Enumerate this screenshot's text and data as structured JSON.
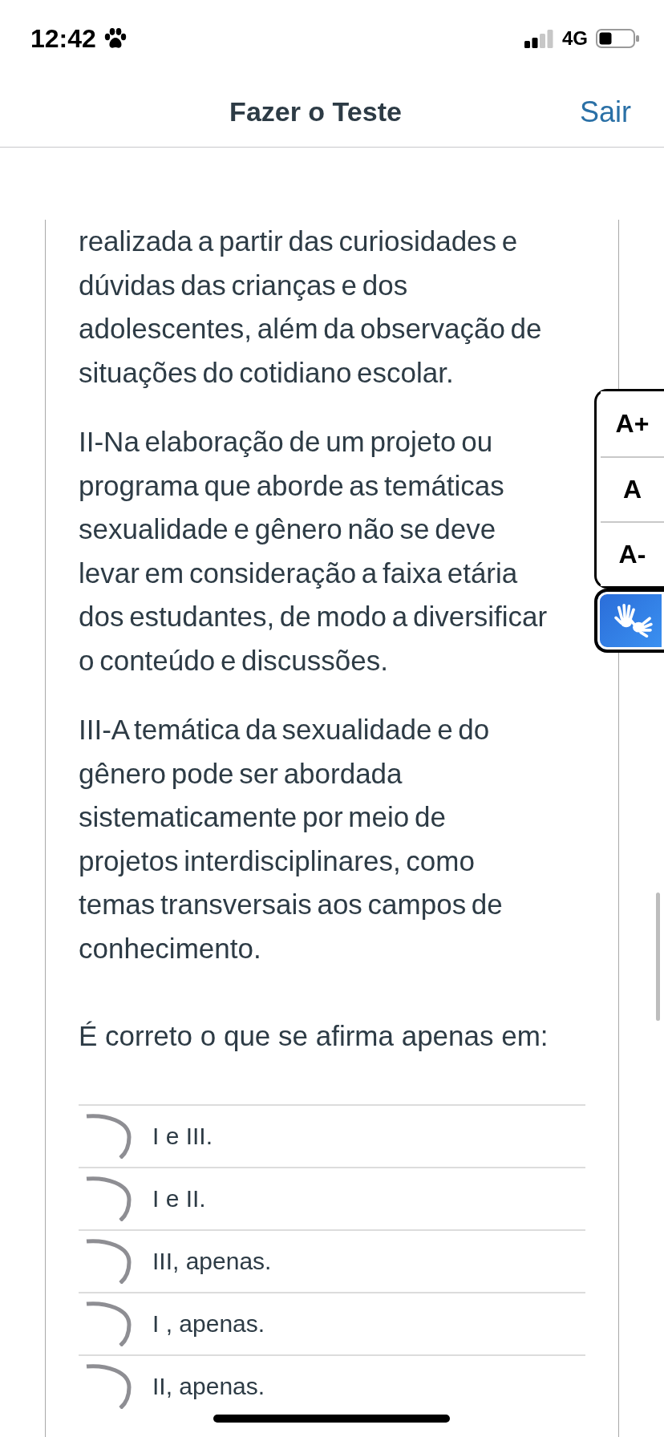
{
  "status_bar": {
    "time": "12:42",
    "network": "4G"
  },
  "header": {
    "title": "Fazer o Teste",
    "exit_link": "Sair"
  },
  "question": {
    "paragraphs": [
      "realizada a partir das curiosidades e dúvidas das crianças e dos adolescentes, além da observação de situações do cotidiano escolar.",
      "II-Na elaboração de um projeto ou programa que aborde as temáticas sexualidade e gênero não se deve levar em consideração a faixa etária dos estudantes, de modo a diversificar o conteúdo e discussões.",
      "III-A temática da sexualidade e do gênero pode ser abordada sistematicamente por meio de projetos interdisciplinares, como temas transversais aos campos de conhecimento."
    ],
    "prompt": "É correto o que se afirma apenas em:"
  },
  "options": [
    {
      "label": "I e III.",
      "selected": false
    },
    {
      "label": "I e II.",
      "selected": false
    },
    {
      "label": "III, apenas.",
      "selected": false
    },
    {
      "label": "I , apenas.",
      "selected": false
    },
    {
      "label": "II, apenas.",
      "selected": false
    }
  ],
  "text_size_controls": [
    {
      "label": "A+"
    },
    {
      "label": "A"
    },
    {
      "label": "A-"
    }
  ]
}
